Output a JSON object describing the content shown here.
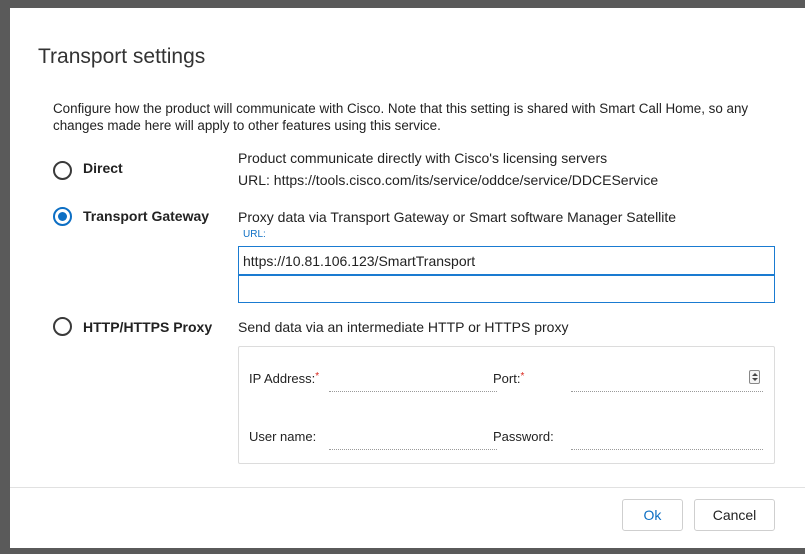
{
  "dialog": {
    "title": "Transport settings",
    "description": "Configure how the product will communicate with Cisco. Note that this setting is shared with Smart Call Home, so any changes made here will apply to other features using this service."
  },
  "options": {
    "direct": {
      "label": "Direct",
      "selected": false,
      "desc": "Product communicate directly with Cisco's licensing servers",
      "url_text": "URL: https://tools.cisco.com/its/service/oddce/service/DDCEService"
    },
    "gateway": {
      "label": "Transport Gateway",
      "selected": true,
      "desc": "Proxy data via Transport Gateway or Smart software Manager Satellite",
      "url_label": "URL:",
      "url_value": "https://10.81.106.123/SmartTransport",
      "second_value": ""
    },
    "proxy": {
      "label": "HTTP/HTTPS Proxy",
      "selected": false,
      "desc": "Send data via an intermediate HTTP or HTTPS proxy",
      "ip_label": "IP Address:",
      "port_label": "Port:",
      "user_label": "User name:",
      "password_label": "Password:",
      "required_mark": "*"
    }
  },
  "buttons": {
    "ok": "Ok",
    "cancel": "Cancel"
  },
  "colors": {
    "accent": "#0d6fc4",
    "required": "#d9261c"
  }
}
